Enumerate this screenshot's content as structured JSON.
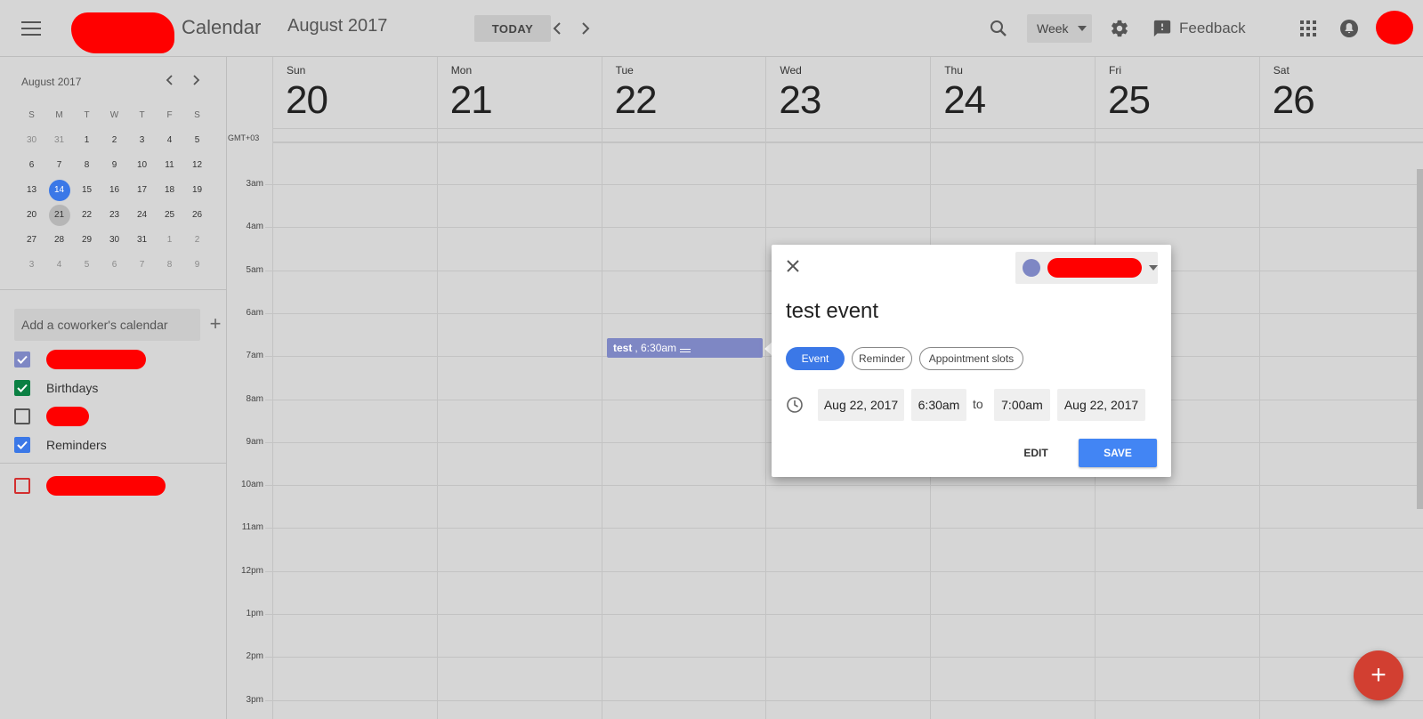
{
  "header": {
    "app_title": "Calendar",
    "month_title": "August 2017",
    "today_label": "TODAY",
    "view_label": "Week",
    "feedback_label": "Feedback"
  },
  "sidebar": {
    "mini_month": "August 2017",
    "weekday_heads": [
      "S",
      "M",
      "T",
      "W",
      "T",
      "F",
      "S"
    ],
    "weeks": [
      [
        "30",
        "31",
        "1",
        "2",
        "3",
        "4",
        "5"
      ],
      [
        "6",
        "7",
        "8",
        "9",
        "10",
        "11",
        "12"
      ],
      [
        "13",
        "14",
        "15",
        "16",
        "17",
        "18",
        "19"
      ],
      [
        "20",
        "21",
        "22",
        "23",
        "24",
        "25",
        "26"
      ],
      [
        "27",
        "28",
        "29",
        "30",
        "31",
        "1",
        "2"
      ],
      [
        "3",
        "4",
        "5",
        "6",
        "7",
        "8",
        "9"
      ]
    ],
    "today_day": "14",
    "selected_day": "21",
    "coworker_placeholder": "Add a coworker's calendar",
    "calendars": [
      {
        "label": "",
        "checked": true,
        "color": "#7e87c4"
      },
      {
        "label": "Birthdays",
        "checked": true,
        "color": "#0b8043"
      },
      {
        "label": "",
        "checked": false,
        "color": "#555555"
      },
      {
        "label": "Reminders",
        "checked": true,
        "color": "#3b78e7"
      },
      {
        "label": "",
        "checked": false,
        "color": "#d32f2f"
      }
    ]
  },
  "week": {
    "timezone": "GMT+03",
    "days": [
      {
        "dow": "Sun",
        "num": "20"
      },
      {
        "dow": "Mon",
        "num": "21"
      },
      {
        "dow": "Tue",
        "num": "22"
      },
      {
        "dow": "Wed",
        "num": "23"
      },
      {
        "dow": "Thu",
        "num": "24"
      },
      {
        "dow": "Fri",
        "num": "25"
      },
      {
        "dow": "Sat",
        "num": "26"
      }
    ],
    "hours": [
      "3am",
      "4am",
      "5am",
      "6am",
      "7am",
      "8am",
      "9am",
      "10am",
      "11am",
      "12pm",
      "1pm",
      "2pm",
      "3pm"
    ]
  },
  "event_chip": {
    "title": "test",
    "time": ", 6:30am"
  },
  "dialog": {
    "title_value": "test event",
    "types": {
      "event": "Event",
      "reminder": "Reminder",
      "slots": "Appointment slots"
    },
    "start_date": "Aug 22, 2017",
    "start_time": "6:30am",
    "to_label": "to",
    "end_time": "7:00am",
    "end_date": "Aug 22, 2017",
    "edit_label": "EDIT",
    "save_label": "SAVE"
  },
  "colors": {
    "accent": "#3b78e7",
    "save": "#4285f4",
    "event": "#7e87c4",
    "fab": "#d23f31"
  }
}
